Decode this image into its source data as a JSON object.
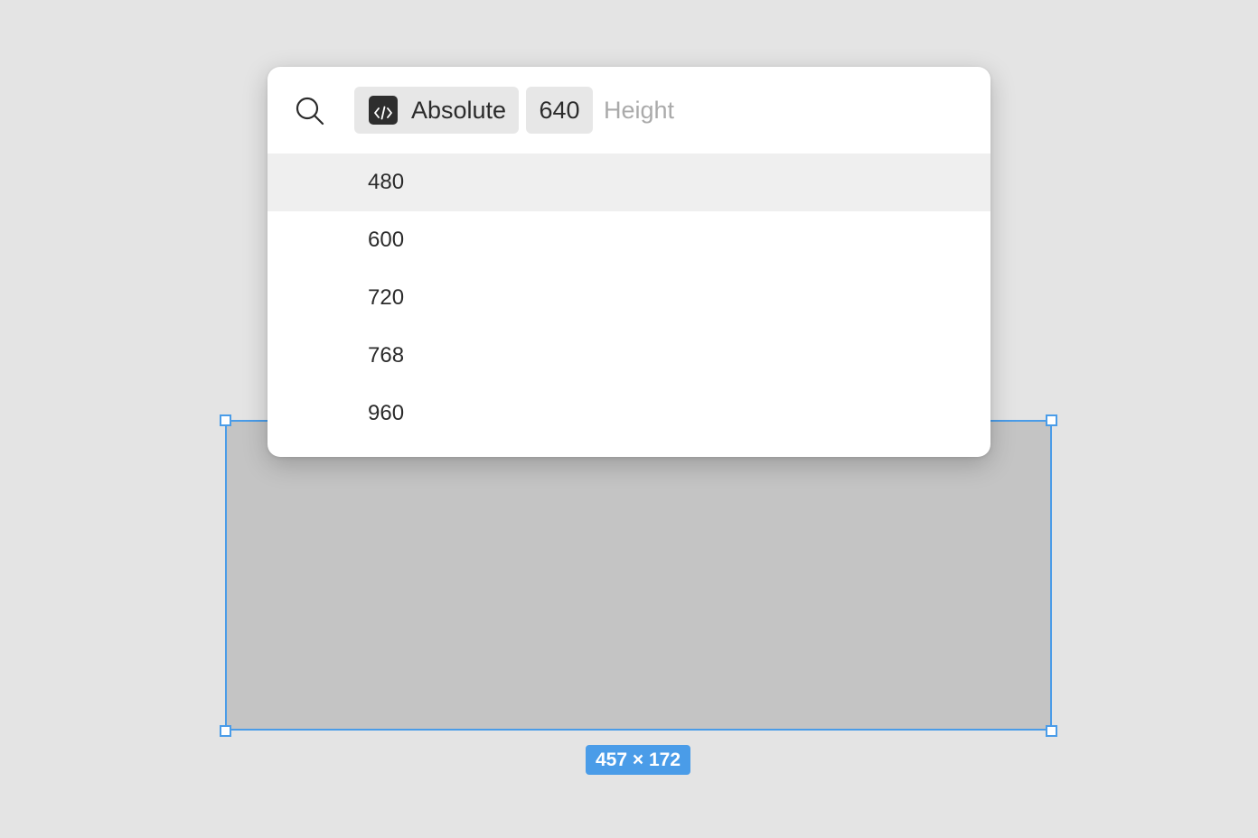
{
  "canvas": {
    "background": "#e4e4e4",
    "frame_fill": "#c4c4c4",
    "selection_color": "#4a9ce8",
    "size_badge": "457 × 172"
  },
  "popover": {
    "search_icon": "search-icon",
    "mode_chip": {
      "icon": "code-icon",
      "label": "Absolute"
    },
    "value_chip": "640",
    "input_placeholder": "Height",
    "input_value": "",
    "options": [
      {
        "label": "480",
        "highlighted": true
      },
      {
        "label": "600",
        "highlighted": false
      },
      {
        "label": "720",
        "highlighted": false
      },
      {
        "label": "768",
        "highlighted": false
      },
      {
        "label": "960",
        "highlighted": false
      }
    ]
  }
}
